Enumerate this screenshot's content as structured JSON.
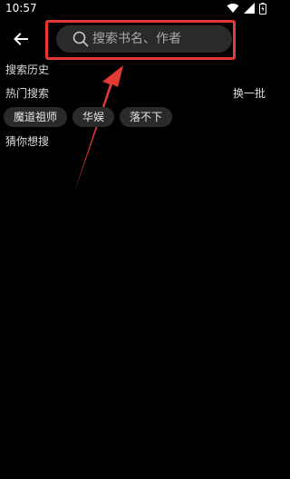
{
  "status_bar": {
    "time": "10:57",
    "icons": [
      "wifi-icon",
      "signal-icon",
      "battery-icon"
    ]
  },
  "header": {
    "back_icon": "back-arrow-icon",
    "search": {
      "placeholder": "搜索书名、作者",
      "value": ""
    }
  },
  "sections": {
    "history_title": "搜索历史",
    "hot_title": "热门搜索",
    "refresh_label": "换一批",
    "hot_tags": [
      "魔道祖师",
      "华娱",
      "落不下"
    ],
    "guess_title": "猜你想搜"
  },
  "colors": {
    "background": "#000000",
    "search_bg": "#2a2a2a",
    "tag_bg": "#2a2a2a",
    "annotation_red": "#e53935"
  }
}
